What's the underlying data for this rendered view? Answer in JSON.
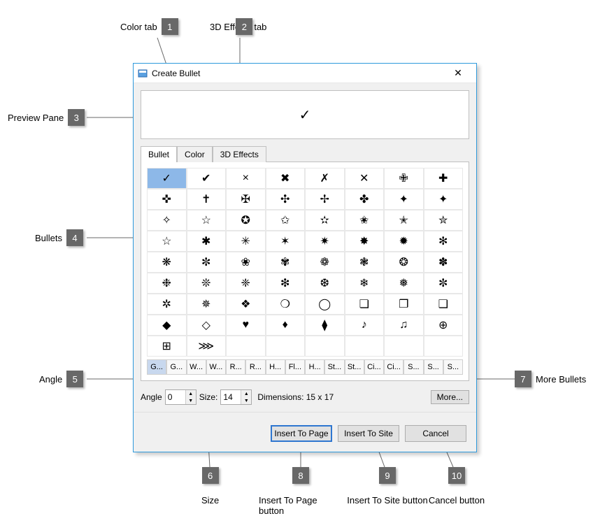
{
  "dialog": {
    "title": "Create Bullet",
    "close_symbol": "✕"
  },
  "preview": {
    "symbol": "✓"
  },
  "tabs": {
    "bullet": "Bullet",
    "color": "Color",
    "effects": "3D Effects"
  },
  "bullets": [
    "✓",
    "✔",
    "×",
    "✖",
    "✗",
    "✕",
    "✙",
    "✚",
    "✜",
    "✝",
    "✠",
    "✣",
    "✢",
    "✤",
    "✦",
    "✦",
    "✧",
    "☆",
    "✪",
    "✩",
    "✫",
    "✬",
    "✭",
    "✮",
    "☆",
    "✱",
    "✳",
    "✶",
    "✷",
    "✸",
    "✹",
    "✻",
    "❋",
    "✼",
    "❀",
    "✾",
    "❁",
    "❃",
    "❂",
    "✽",
    "❉",
    "❊",
    "❈",
    "❇",
    "❆",
    "❄",
    "❅",
    "✼",
    "✲",
    "✵",
    "❖",
    "❍",
    "◯",
    "❏",
    "❐",
    "❑",
    "◆",
    "◇",
    "♥",
    "♦",
    "⧫",
    "♪",
    "♫",
    "⊕",
    "⊞",
    "⋙",
    "",
    "",
    "",
    "",
    "",
    "",
    "",
    "",
    "",
    "",
    "",
    "",
    "",
    ""
  ],
  "bullets_rows": 8,
  "bullets_cols": 8,
  "short_row": [
    "⊞",
    "⋙"
  ],
  "categories": [
    "G...",
    "G...",
    "W...",
    "W...",
    "R...",
    "R...",
    "H...",
    "Fl...",
    "H...",
    "St...",
    "St...",
    "Ci...",
    "Ci...",
    "S...",
    "S...",
    "S..."
  ],
  "controls": {
    "angle_label": "Angle",
    "angle_value": "0",
    "size_label": "Size:",
    "size_value": "14",
    "dimensions_label": "Dimensions: 15 x 17",
    "more_label": "More..."
  },
  "buttons": {
    "insert_page": "Insert To Page",
    "insert_site": "Insert To Site",
    "cancel": "Cancel"
  },
  "callouts": {
    "c1": "Color tab",
    "c2": "3D Effects tab",
    "c3": "Preview Pane",
    "c4": "Bullets",
    "c5": "Angle",
    "c6": "Size",
    "c7": "More Bullets",
    "c8": "Insert To Page button",
    "c9": "Insert To Site button",
    "c10": "Cancel button"
  }
}
